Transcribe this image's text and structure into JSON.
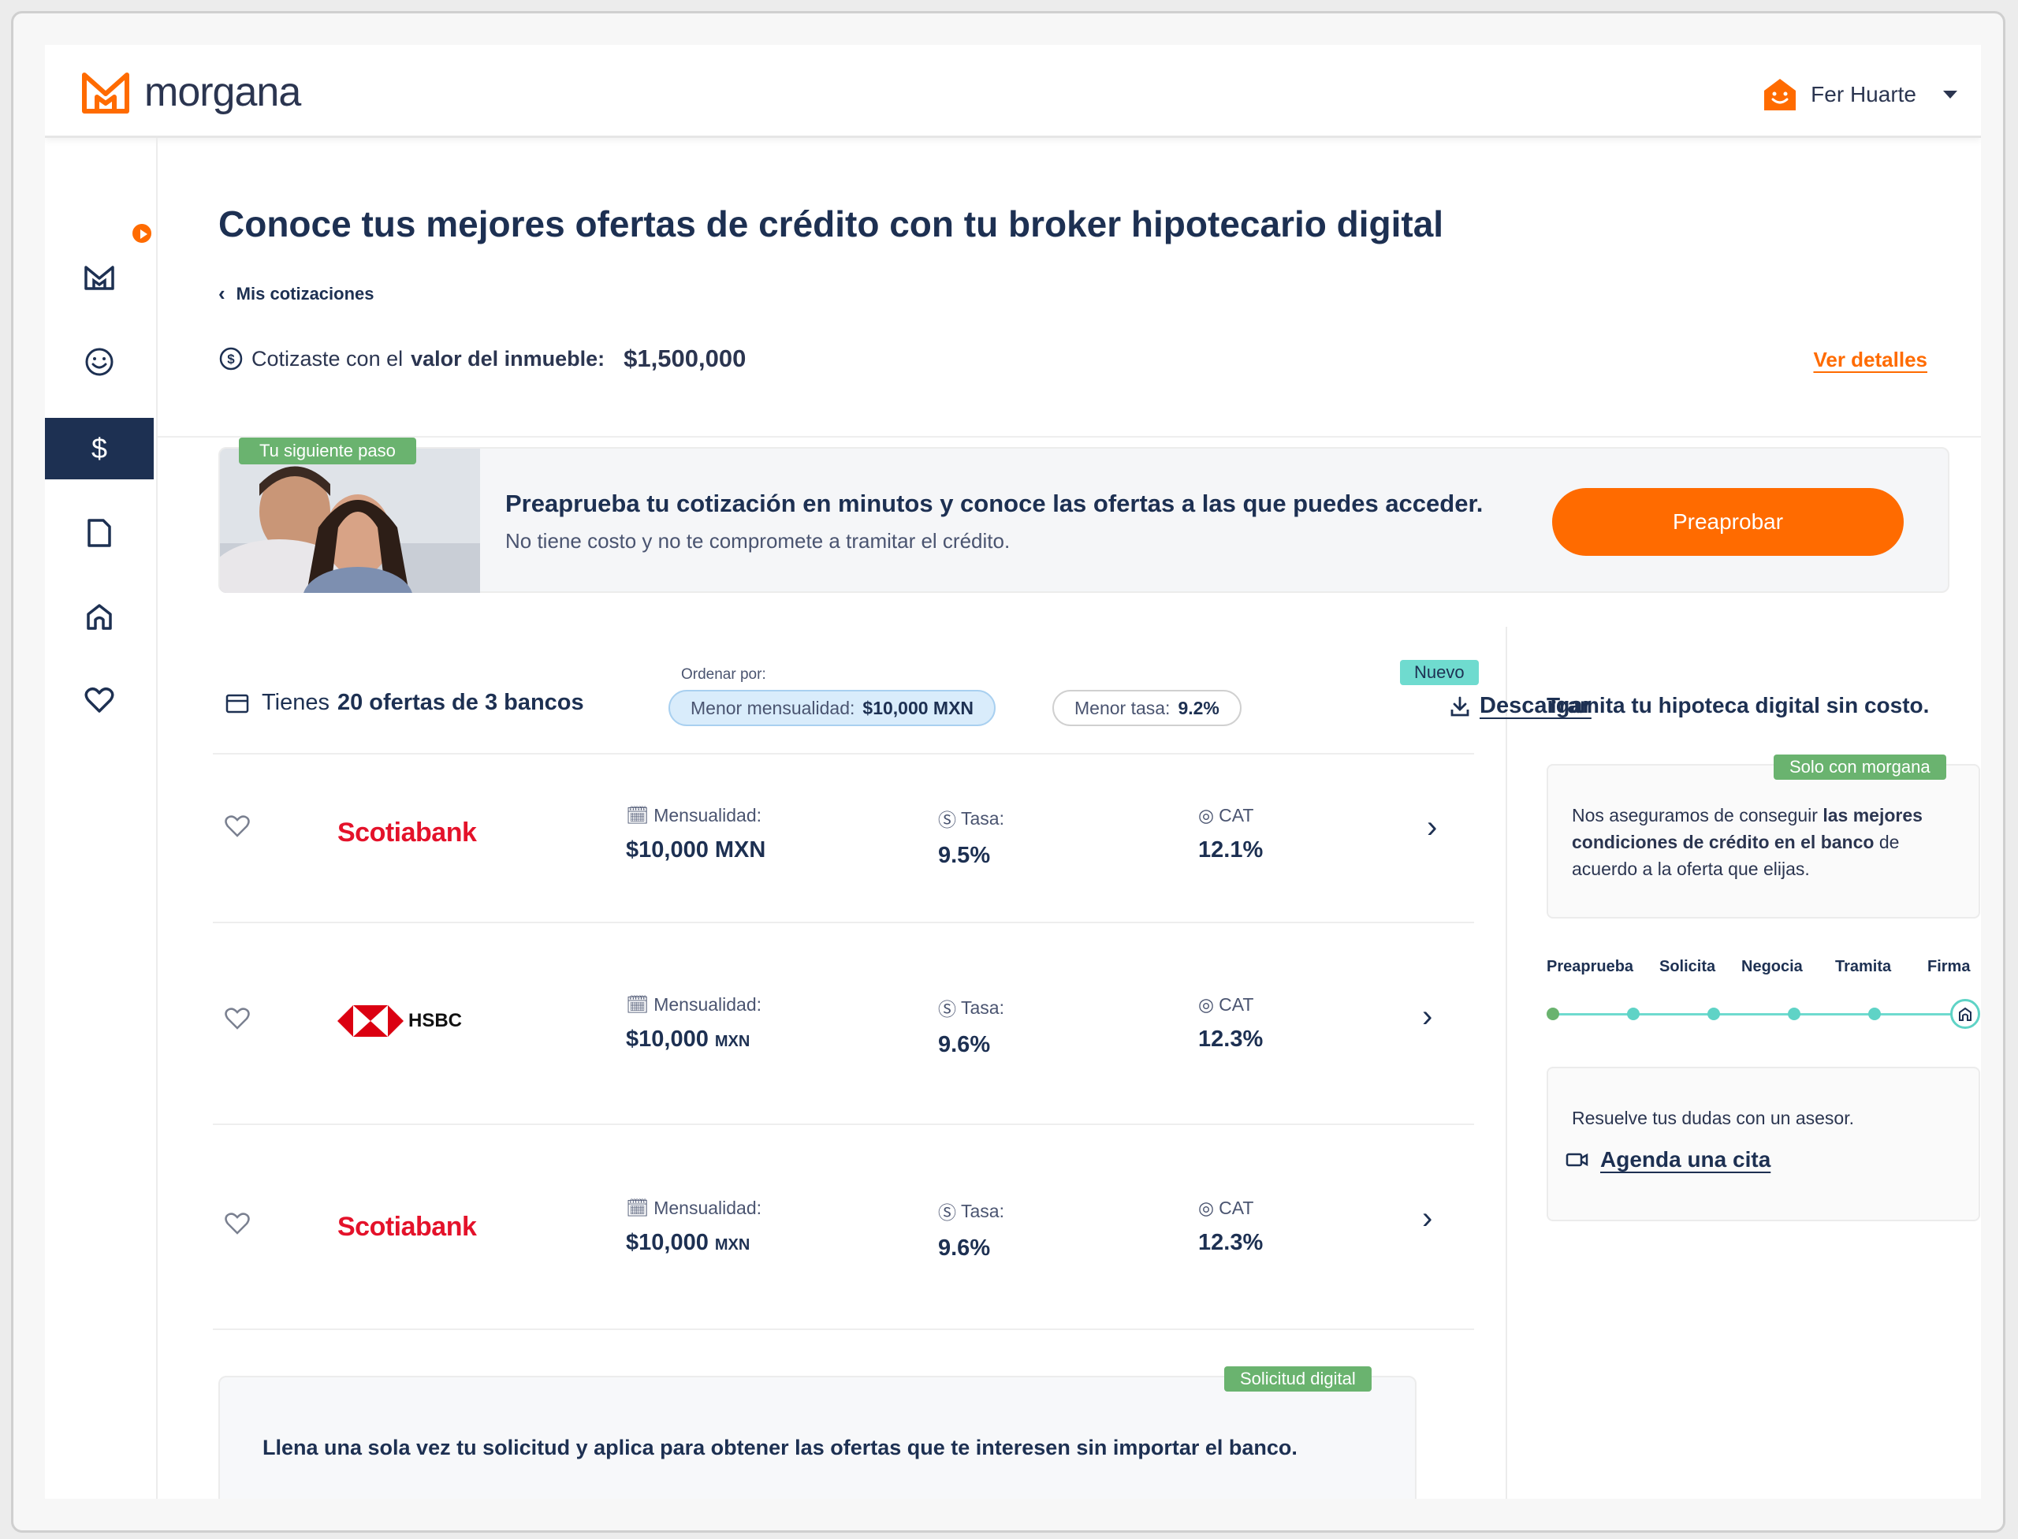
{
  "header": {
    "logo_text": "morgana",
    "user_name": "Fer Huarte"
  },
  "sidebar": {
    "items": [
      {
        "icon": "morgana-logo-icon",
        "active": false
      },
      {
        "icon": "smiley-icon",
        "active": false
      },
      {
        "icon": "dollar-icon",
        "label": "$",
        "active": true
      },
      {
        "icon": "document-icon",
        "active": false
      },
      {
        "icon": "home-icon",
        "active": false
      },
      {
        "icon": "heart-icon",
        "active": false
      }
    ],
    "badge_icon": "play-icon"
  },
  "main": {
    "title": "Conoce tus mejores ofertas de crédito con tu broker hipotecario digital",
    "breadcrumb": "Mis cotizaciones",
    "quote_prefix": "Cotizaste con el",
    "quote_bold": "valor del inmueble:",
    "quote_amount": "$1,500,000",
    "details_link": "Ver detalles"
  },
  "banner": {
    "tag": "Tu siguiente paso",
    "title": "Preaprueba tu cotización en minutos y conoce las ofertas a las que puedes acceder.",
    "subtitle": "No tiene costo y no te compromete a tramitar el crédito.",
    "button": "Preaprobar"
  },
  "offers": {
    "count_prefix": "Tienes",
    "count_bold": "20 ofertas de 3 bancos",
    "order_label": "Ordenar por:",
    "sort_active_label": "Menor mensualidad:",
    "sort_active_value": "$10,000 MXN",
    "sort_inactive_label": "Menor tasa:",
    "sort_inactive_value": "9.2%",
    "new_tag": "Nuevo",
    "download": "Descargar",
    "labels": {
      "mensualidad": "Mensualidad:",
      "tasa": "Tasa:",
      "cat": "CAT"
    },
    "rows": [
      {
        "bank": "Scotiabank",
        "mensualidad": "$10,000 MXN",
        "unit": "",
        "tasa": "9.5%",
        "cat": "12.1%"
      },
      {
        "bank": "HSBC",
        "mensualidad": "$10,000",
        "unit": "MXN",
        "tasa": "9.6%",
        "cat": "12.3%"
      },
      {
        "bank": "Scotiabank",
        "mensualidad": "$10,000",
        "unit": "MXN",
        "tasa": "9.6%",
        "cat": "12.3%"
      }
    ],
    "solicitud_tag": "Solicitud digital",
    "solicitud_text": "Llena una sola vez tu solicitud y aplica para obtener las ofertas que te interesen sin importar el banco."
  },
  "right": {
    "title": "Tramita tu hipoteca digital sin costo.",
    "tag": "Solo con morgana",
    "card_text_1": "Nos aseguramos de conseguir",
    "card_bold": "las mejores condiciones de crédito en el banco",
    "card_text_2": "de acuerdo a la oferta que elijas.",
    "steps": [
      "Preaprueba",
      "Solicita",
      "Negocia",
      "Tramita",
      "Firma"
    ],
    "advisor_text": "Resuelve tus dudas con un asesor.",
    "advisor_link": "Agenda una cita"
  },
  "colors": {
    "accent": "#ff6b00",
    "navy": "#1d3052",
    "teal": "#6fdbcf",
    "green": "#6ab36f",
    "scotia_red": "#e4122a"
  }
}
